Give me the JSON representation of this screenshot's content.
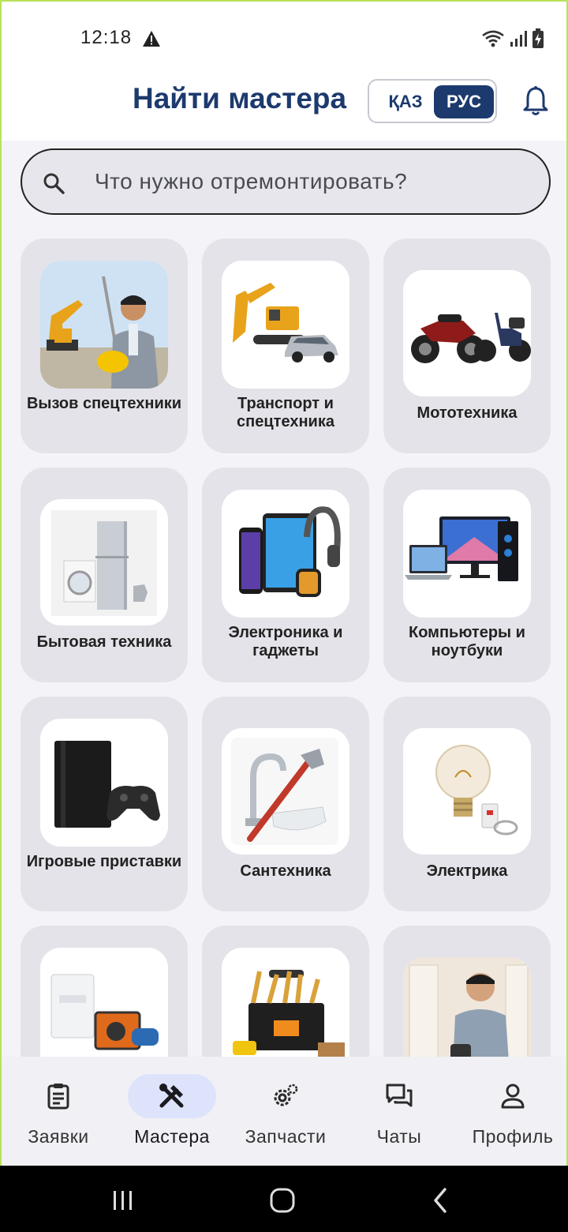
{
  "status_bar": {
    "time": "12:18",
    "icons": [
      "alert-icon",
      "wifi-icon",
      "signal-icon",
      "battery-charging-icon"
    ]
  },
  "header": {
    "title": "Найти мастера",
    "lang_kaz": "ҚАЗ",
    "lang_rus": "РУС",
    "active_lang": "РУС",
    "notification_icon": "bell-icon"
  },
  "search": {
    "placeholder": "Что нужно отремонтировать?"
  },
  "categories": [
    {
      "label": "Вызов спецтехники"
    },
    {
      "label": "Транспорт и спецтехника"
    },
    {
      "label": "Мототехника"
    },
    {
      "label": "Бытовая техника"
    },
    {
      "label": "Электроника и гаджеты"
    },
    {
      "label": "Компьютеры и ноутбуки"
    },
    {
      "label": "Игровые приставки"
    },
    {
      "label": "Сантехника"
    },
    {
      "label": "Электрика"
    },
    {
      "label": ""
    },
    {
      "label": ""
    },
    {
      "label": ""
    }
  ],
  "bottom_nav": {
    "active": "Мастера",
    "items": [
      {
        "label": "Заявки",
        "icon": "clipboard-icon"
      },
      {
        "label": "Мастера",
        "icon": "tools-icon"
      },
      {
        "label": "Запчасти",
        "icon": "gears-icon"
      },
      {
        "label": "Чаты",
        "icon": "chat-icon"
      },
      {
        "label": "Профиль",
        "icon": "person-icon"
      }
    ]
  },
  "colors": {
    "brand": "#1d3a6e",
    "card_bg": "#e3e3e9",
    "active_nav_pill": "#dde3fb"
  }
}
